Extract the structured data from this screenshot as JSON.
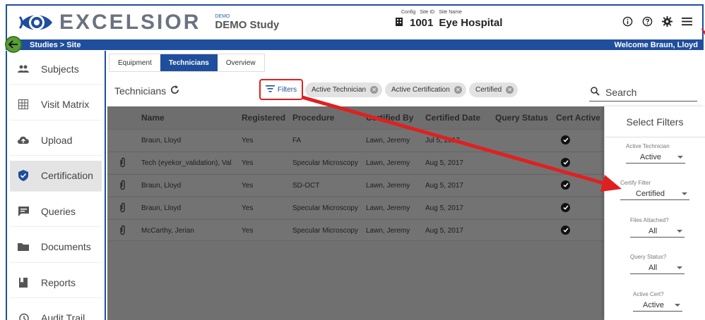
{
  "header": {
    "logo_text": "EXCELSIOR",
    "study_small": "DEMO",
    "study_name": "DEMO Study",
    "config_label": "Config",
    "site_id_label": "Site ID",
    "site_name_label": "Site Name",
    "site_id": "1001",
    "site_name": "Eye Hospital"
  },
  "bar": {
    "breadcrumb": "Studies > Site",
    "welcome": "Welcome Braun, Lloyd"
  },
  "sidebar": {
    "items": [
      {
        "label": "Subjects",
        "icon": "people-icon"
      },
      {
        "label": "Visit Matrix",
        "icon": "grid-icon"
      },
      {
        "label": "Upload",
        "icon": "cloud-upload-icon"
      },
      {
        "label": "Certification",
        "icon": "shield-check-icon",
        "active": true
      },
      {
        "label": "Queries",
        "icon": "chat-icon"
      },
      {
        "label": "Documents",
        "icon": "folder-icon"
      },
      {
        "label": "Reports",
        "icon": "bookmark-icon"
      },
      {
        "label": "Audit Trail",
        "icon": "history-icon"
      }
    ]
  },
  "tabs": [
    "Equipment",
    "Technicians",
    "Overview"
  ],
  "toolbar": {
    "title": "Technicians",
    "filters_label": "Filters",
    "chips": [
      "Active Technician",
      "Active Certification",
      "Certified"
    ],
    "search_placeholder": "Search"
  },
  "table": {
    "columns": [
      "Name",
      "Registered",
      "Procedure",
      "Certified By",
      "Certified Date",
      "Query Status",
      "Cert Active"
    ],
    "rows": [
      {
        "attachment": false,
        "name": "Braun, Lloyd",
        "registered": "Yes",
        "procedure": "FA",
        "certified_by": "Lawn, Jeremy",
        "date": "Jul 5, 2017"
      },
      {
        "attachment": true,
        "name": "Tech (eyekor_validation), Val",
        "registered": "Yes",
        "procedure": "Specular Microscopy",
        "certified_by": "Lawn, Jeremy",
        "date": "Aug 5, 2017"
      },
      {
        "attachment": true,
        "name": "Braun, Lloyd",
        "registered": "Yes",
        "procedure": "SD-OCT",
        "certified_by": "Lawn, Jeremy",
        "date": "Aug 5, 2017"
      },
      {
        "attachment": true,
        "name": "Braun, Lloyd",
        "registered": "Yes",
        "procedure": "Specular Microscopy",
        "certified_by": "Lawn, Jeremy",
        "date": "Aug 5, 2017"
      },
      {
        "attachment": true,
        "name": "McCarthy, Jerian",
        "registered": "Yes",
        "procedure": "Specular Microscopy",
        "certified_by": "Lawn, Jeremy",
        "date": "Aug 5, 2017"
      }
    ]
  },
  "filter_panel": {
    "title": "Select Filters",
    "filters": [
      {
        "label": "Active Technician",
        "value": "Active"
      },
      {
        "label": "Certify Filter",
        "value": "Certified"
      },
      {
        "label": "Files Attached?",
        "value": "All"
      },
      {
        "label": "Query Status?",
        "value": "All"
      },
      {
        "label": "Active Cert?",
        "value": "Active"
      }
    ]
  },
  "colors": {
    "brand_blue": "#1f4e9c",
    "accent_red": "#e02020",
    "back_green": "#5a9e3a"
  }
}
